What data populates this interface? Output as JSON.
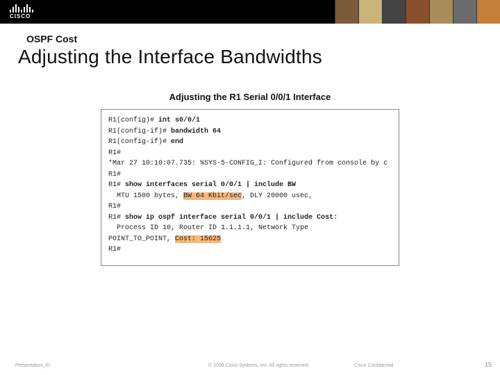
{
  "logo_text": "CISCO",
  "subtitle": "OSPF Cost",
  "title": "Adjusting the Interface Bandwidths",
  "figure_title": "Adjusting the R1 Serial 0/0/1 Interface",
  "terminal": {
    "l1_prompt": "R1(config)# ",
    "l1_cmd": "int s0/0/1",
    "l2_prompt": "R1(config-if)# ",
    "l2_cmd": "bandwidth 64",
    "l3_prompt": "R1(config-if)# ",
    "l3_cmd": "end",
    "l4": "R1#",
    "l5": "*Mar 27 10:10:07.735: %SYS-5-CONFIG_I: Configured from console by c",
    "l6": "R1#",
    "l7_prompt": "R1# ",
    "l7_cmd": "show interfaces serial 0/0/1 | include BW",
    "l8_a": "  MTU 1500 bytes, ",
    "l8_hl": "BW 64 Kbit/sec",
    "l8_b": ", DLY 20000 usec,",
    "l9": "R1#",
    "l10_prompt": "R1# ",
    "l10_cmd": "show ip ospf interface serial 0/0/1 | include Cost:",
    "l11": "  Process ID 10, Router ID 1.1.1.1, Network Type",
    "l12_a": "POINT_TO_POINT, ",
    "l12_hl": "Cost: 15625",
    "l13": "R1#"
  },
  "footer": {
    "pid": "Presentation_ID",
    "copyright": "© 2008 Cisco Systems, Inc. All rights reserved.",
    "confidential": "Cisco Confidential",
    "page": "15"
  }
}
